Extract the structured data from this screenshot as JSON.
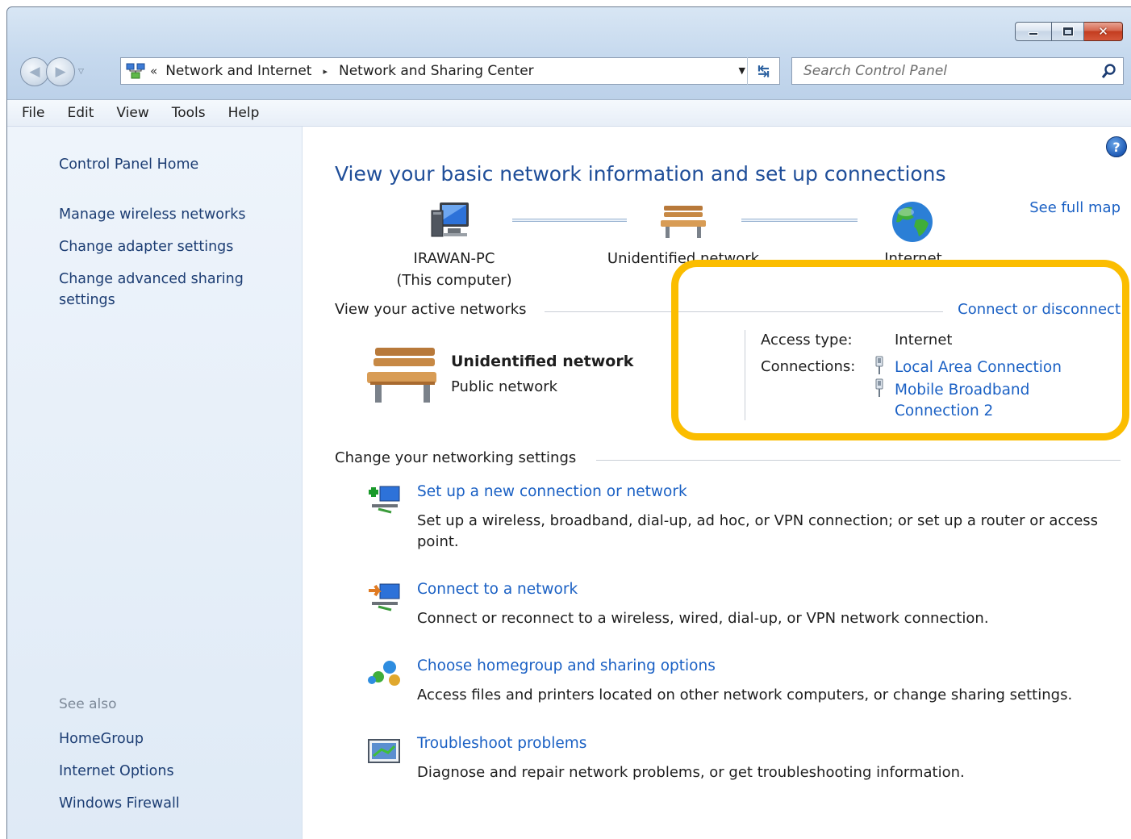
{
  "window": {
    "caption_buttons": {
      "minimize": "minimize",
      "maximize": "maximize",
      "close": "close"
    }
  },
  "address_bar": {
    "overflow": "«",
    "breadcrumbs": [
      "Network and Internet",
      "Network and Sharing Center"
    ],
    "separator": "▸"
  },
  "search": {
    "placeholder": "Search Control Panel"
  },
  "menu": [
    "File",
    "Edit",
    "View",
    "Tools",
    "Help"
  ],
  "sidebar": {
    "home": "Control Panel Home",
    "tasks": [
      "Manage wireless networks",
      "Change adapter settings",
      "Change advanced sharing settings"
    ],
    "see_also_label": "See also",
    "see_also": [
      "HomeGroup",
      "Internet Options",
      "Windows Firewall"
    ]
  },
  "main": {
    "title": "View your basic network information and set up connections",
    "see_full_map": "See full map",
    "map": {
      "computer_name": "IRAWAN-PC",
      "computer_sub": "(This computer)",
      "network": "Unidentified network",
      "internet": "Internet"
    },
    "active_networks": {
      "heading": "View your active networks",
      "connect_link": "Connect or disconnect",
      "network_name": "Unidentified network",
      "network_category": "Public network",
      "access_type_label": "Access type:",
      "access_type_value": "Internet",
      "connections_label": "Connections:",
      "connections": [
        "Local Area Connection",
        "Mobile Broadband Connection 2"
      ]
    },
    "change_settings": {
      "heading": "Change your networking settings",
      "tasks": [
        {
          "link": "Set up a new connection or network",
          "desc": "Set up a wireless, broadband, dial-up, ad hoc, or VPN connection; or set up a router or access point."
        },
        {
          "link": "Connect to a network",
          "desc": "Connect or reconnect to a wireless, wired, dial-up, or VPN network connection."
        },
        {
          "link": "Choose homegroup and sharing options",
          "desc": "Access files and printers located on other network computers, or change sharing settings."
        },
        {
          "link": "Troubleshoot problems",
          "desc": "Diagnose and repair network problems, or get troubleshooting information."
        }
      ]
    }
  },
  "colors": {
    "link": "#1a60c4",
    "title": "#1f4e99",
    "highlight": "#fbbd00"
  }
}
